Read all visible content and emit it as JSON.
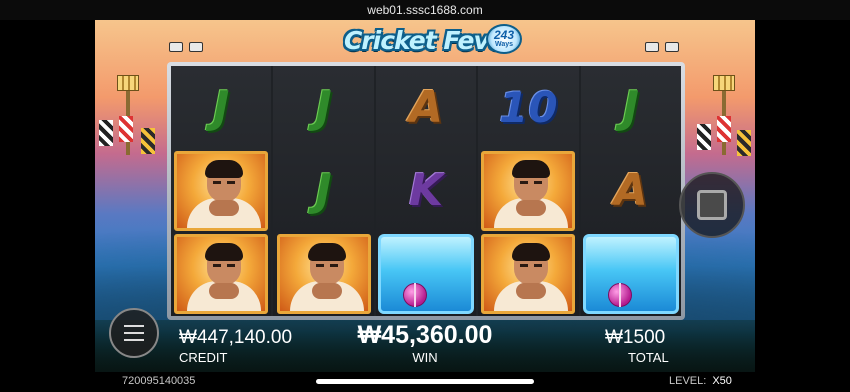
{
  "browser": {
    "url": "web01.sssc1688.com"
  },
  "game": {
    "logo_text": "Cricket Fever",
    "logo_badge_number": "243",
    "logo_badge_label": "Ways"
  },
  "reels": [
    [
      "J",
      "player",
      "player"
    ],
    [
      "J",
      "J",
      "player"
    ],
    [
      "A",
      "K",
      "ice-ball"
    ],
    [
      "10",
      "player",
      "player"
    ],
    [
      "J",
      "A",
      "ice-ball"
    ]
  ],
  "hud": {
    "credit_value": "₩447,140.00",
    "credit_label": "CREDIT",
    "win_value": "₩45,360.00",
    "win_label": "WIN",
    "total_value": "₩1500",
    "total_label": "TOTAL"
  },
  "footer": {
    "session_id": "720095140035",
    "level_label": "LEVEL:",
    "level_value": "X50"
  },
  "icons": {
    "menu": "hamburger-icon",
    "stop": "stop-square-icon",
    "spotlight": "floodlight-icon"
  }
}
